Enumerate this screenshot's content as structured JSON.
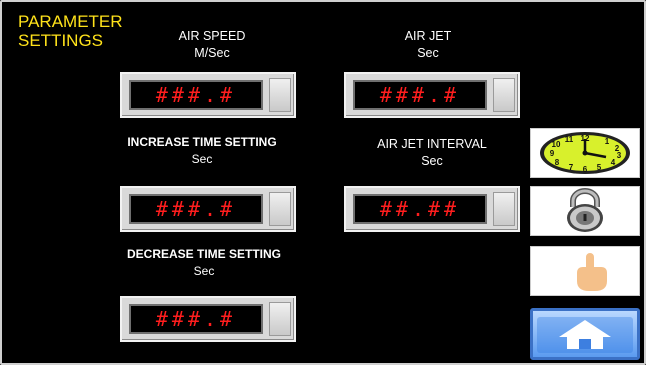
{
  "page": {
    "title_line1": "PARAMETER",
    "title_line2": "SETTINGS"
  },
  "fields": {
    "air_speed": {
      "label": "AIR SPEED",
      "unit": "M/Sec",
      "value": "###.#"
    },
    "air_jet": {
      "label": "AIR JET",
      "unit": "Sec",
      "value": "###.#"
    },
    "increase_time": {
      "label": "INCREASE TIME SETTING",
      "unit": "Sec",
      "value": "###.#"
    },
    "air_jet_interval": {
      "label": "AIR JET INTERVAL",
      "unit": "Sec",
      "value": "##.##"
    },
    "decrease_time": {
      "label": "DECREASE TIME SETTING",
      "unit": "Sec",
      "value": "###.#"
    }
  },
  "side_buttons": [
    {
      "icon": "clock-icon"
    },
    {
      "icon": "padlock-icon"
    },
    {
      "icon": "hand-pointer-icon"
    },
    {
      "icon": "home-icon"
    }
  ],
  "colors": {
    "background": "#000000",
    "title": "#ffe21a",
    "value": "#ff1e1e",
    "home_button": "#3b71c6"
  }
}
